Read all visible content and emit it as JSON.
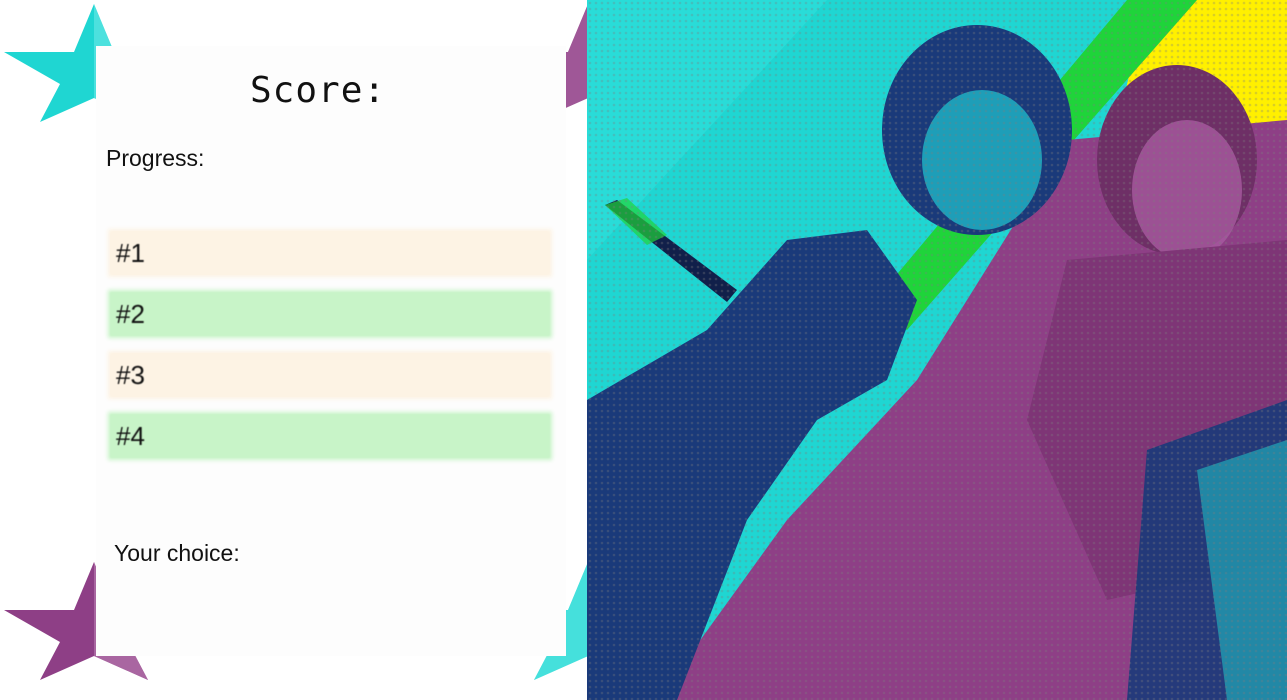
{
  "score_label": "Score:",
  "progress_label": "Progress:",
  "rounds": [
    {
      "label": "#1",
      "status": "pending"
    },
    {
      "label": "#2",
      "status": "correct"
    },
    {
      "label": "#3",
      "status": "pending"
    },
    {
      "label": "#4",
      "status": "correct"
    }
  ],
  "choice_label": "Your choice:",
  "colors": {
    "pending": "#fdf3e4",
    "correct": "#c8f4c8",
    "cyan": "#1fd6d2",
    "purple": "#8e3f86",
    "green": "#1fd43a",
    "yellow": "#fff000",
    "navy": "#1a3a7a"
  },
  "image_description": ""
}
